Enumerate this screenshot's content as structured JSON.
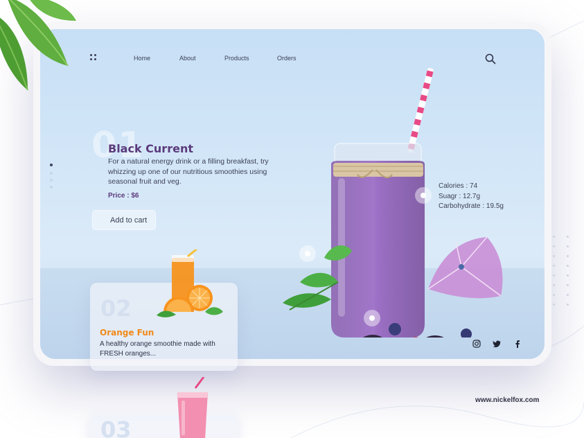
{
  "nav": {
    "items": [
      "Home",
      "About",
      "Products",
      "Orders"
    ]
  },
  "icons": {
    "menu": "menu-dots-icon",
    "search": "search-icon",
    "social": [
      "instagram-icon",
      "twitter-icon",
      "facebook-icon"
    ]
  },
  "hero": {
    "number": "01",
    "title": "Black Current",
    "description": "For a natural energy drink or a filling breakfast, try whizzing up one of our nutritious smoothies using seasonal fruit and veg.",
    "price": "Price : $6",
    "cta": "Add to cart"
  },
  "nutrition": [
    "Calories : 74",
    "Suagr : 12.7g",
    "Carbohydrate : 19.5g"
  ],
  "cards": [
    {
      "number": "02",
      "title": "Orange Fun",
      "description": "A healthy orange smoothie made with FRESH oranges..."
    },
    {
      "number": "03"
    }
  ],
  "footer": {
    "site": "www.nickelfox.com"
  },
  "colors": {
    "accent_purple": "#5b3a7b",
    "accent_orange": "#f08a1a",
    "text": "#3c3f55",
    "screen_bg": "#cfe3f6"
  }
}
